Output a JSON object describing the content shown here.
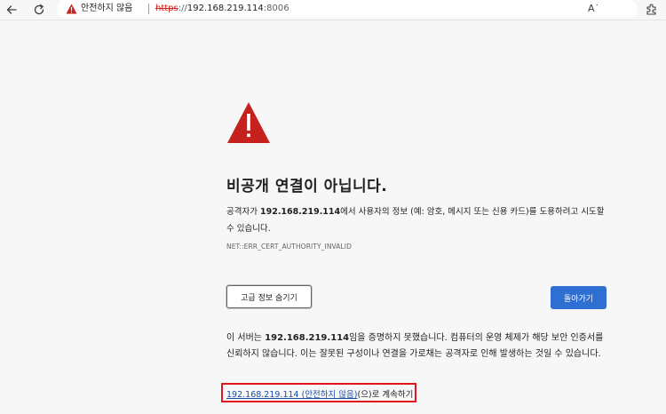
{
  "browser": {
    "security_label": "안전하지 않음",
    "url": {
      "scheme": "https",
      "separator": "://",
      "host": "192.168.219.114",
      "port": ":8006"
    },
    "read_aloud_label": "A˙",
    "icons": {
      "back": "back-arrow-icon",
      "reload": "reload-icon",
      "warning": "warning-triangle-icon",
      "favorite": "star-icon",
      "extensions": "puzzle-icon"
    },
    "accent_color": "#c5221f"
  },
  "page": {
    "heading": "비공개 연결이 아닙니다.",
    "description": {
      "prefix": "공격자가 ",
      "host": "192.168.219.114",
      "suffix": "에서 사용자의 정보 (예: 암호, 메시지 또는 신용 카드)를 도용하려고 시도할 수 있습니다."
    },
    "error_code": "NET::ERR_CERT_AUTHORITY_INVALID",
    "hide_advanced_button": "고급 정보 숨기기",
    "back_button": "돌아가기",
    "details": {
      "prefix": "이 서버는 ",
      "host": "192.168.219.114",
      "suffix": "임을 증명하지 못했습니다. 컴퓨터의 운영 체제가 해당 보안 인증서를 신뢰하지 않습니다. 이는 잘못된 구성이나 연결을 가로채는 공격자로 인해 발생하는 것일 수 있습니다."
    },
    "proceed": {
      "link": "192.168.219.114 (안전하지 않음)",
      "suffix": "(으)로 계속하기"
    },
    "colors": {
      "warning_red": "#c5221f",
      "primary_button": "#2f6fd1",
      "highlight_box": "#e2141c",
      "link": "#1a4fa8"
    }
  }
}
